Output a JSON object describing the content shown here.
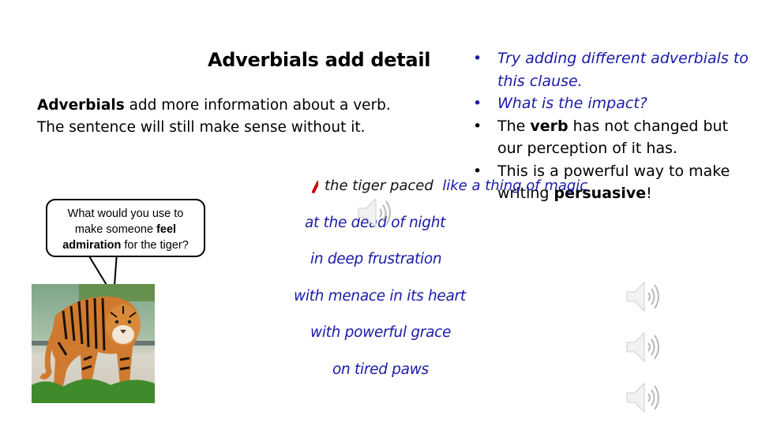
{
  "slide": {
    "title": "Adverbials add detail",
    "intro": {
      "line1_bold": "Adverbials",
      "line1_rest": " add more information about a verb.",
      "line2": "The sentence will still make sense without it."
    },
    "bullets": [
      {
        "text": "Try adding different adverbials to this clause.",
        "style": "italic-blue"
      },
      {
        "text": "What is the impact?",
        "style": "italic-blue"
      },
      {
        "pre": "The ",
        "bold": "verb",
        "post": " has not changed but our perception of it has.",
        "style": "normal"
      },
      {
        "pre": "This is a powerful way to make writing ",
        "bold": "persuasive",
        "post": "!",
        "style": "normal"
      }
    ],
    "speech_bubble": {
      "line1": "What would you use to",
      "line2_pre": "make someone ",
      "line2_bold": "feel",
      "line3_bold": "admiration",
      "line3_post": " for the tiger?"
    },
    "sentence": {
      "clause": "the tiger paced",
      "adverbial": "like a thing of magic"
    },
    "adverbial_options": [
      "at the dead of night",
      "in deep frustration",
      "with menace in its heart",
      "with powerful grace",
      "on tired paws"
    ],
    "image": {
      "subject": "tiger-photo"
    },
    "audio_icons": [
      "speaker-icon",
      "speaker-icon",
      "speaker-icon",
      "speaker-icon"
    ],
    "colors": {
      "accent_blue": "#1a1aa8",
      "comma_red": "#cc0000"
    }
  }
}
